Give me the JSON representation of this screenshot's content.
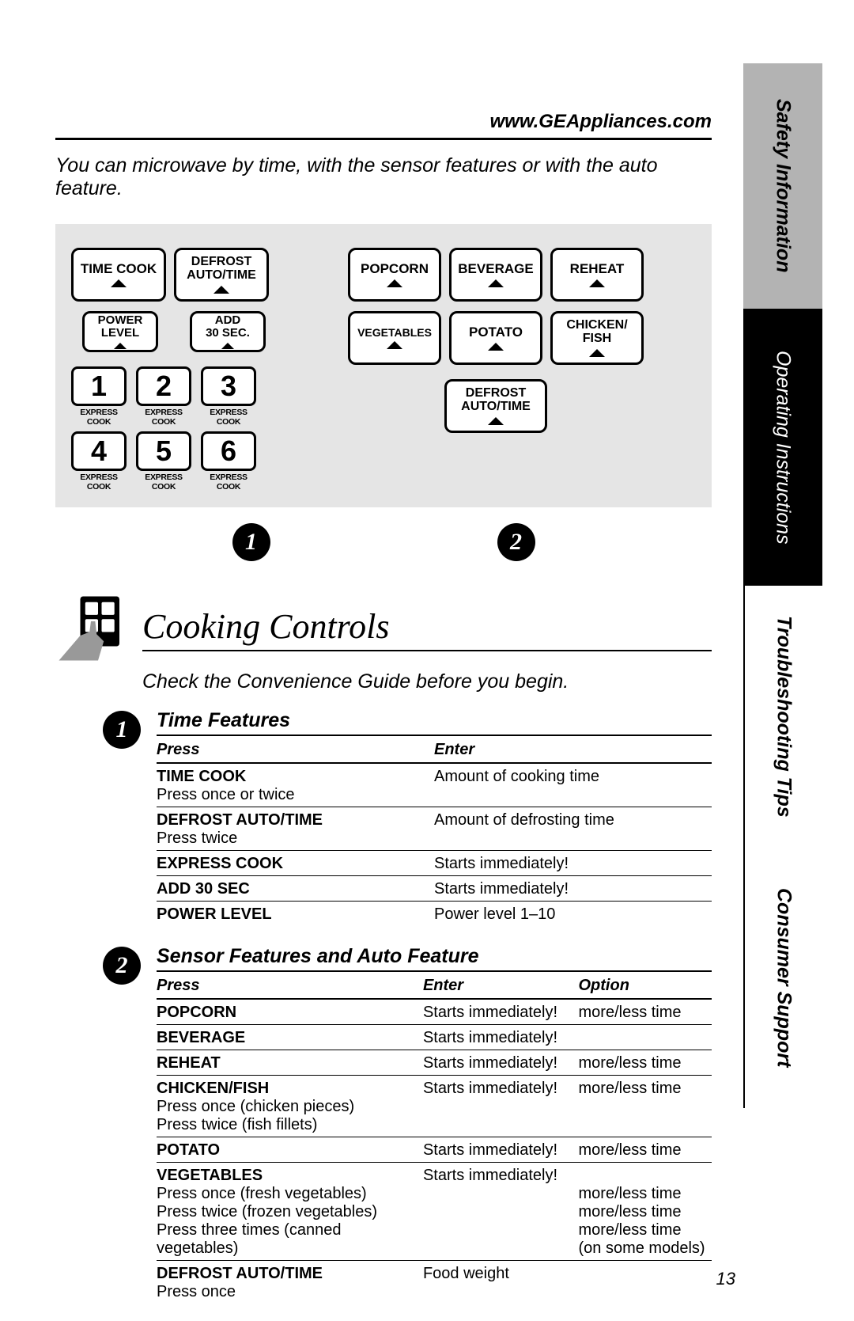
{
  "header": {
    "url": "www.GEAppliances.com",
    "intro": "You can microwave by time, with the sensor features or with the auto feature."
  },
  "panel": {
    "left": {
      "time_cook": "TIME COOK",
      "defrost": "DEFROST AUTO/TIME",
      "power": "POWER LEVEL",
      "add30": "ADD 30 SEC.",
      "express": "EXPRESS COOK",
      "nums": [
        "1",
        "2",
        "3",
        "4",
        "5",
        "6"
      ]
    },
    "right": {
      "popcorn": "POPCORN",
      "beverage": "BEVERAGE",
      "reheat": "REHEAT",
      "veg": "VEGETABLES",
      "potato": "POTATO",
      "chicken": "CHICKEN/ FISH",
      "defrost": "DEFROST AUTO/TIME"
    },
    "callout1": "1",
    "callout2": "2"
  },
  "section": {
    "title": "Cooking Controls",
    "subtitle": "Check the Convenience Guide before you begin."
  },
  "time_features": {
    "title": "Time Features",
    "head_press": "Press",
    "head_enter": "Enter",
    "rows": [
      {
        "press": "TIME COOK",
        "note": "Press once or twice",
        "enter": "Amount of cooking time"
      },
      {
        "press": "DEFROST AUTO/TIME",
        "note": "Press twice",
        "enter": "Amount of defrosting time"
      },
      {
        "press": "EXPRESS COOK",
        "enter": "Starts immediately!"
      },
      {
        "press": "ADD 30 SEC",
        "enter": "Starts immediately!"
      },
      {
        "press": "POWER LEVEL",
        "enter": "Power level 1–10"
      }
    ]
  },
  "sensor_features": {
    "title": "Sensor Features and Auto Feature",
    "head_press": "Press",
    "head_enter": "Enter",
    "head_option": "Option",
    "rows": [
      {
        "press": "POPCORN",
        "enter": "Starts immediately!",
        "option": "more/less time"
      },
      {
        "press": "BEVERAGE",
        "enter": "Starts immediately!",
        "option": ""
      },
      {
        "press": "REHEAT",
        "enter": "Starts immediately!",
        "option": "more/less time"
      },
      {
        "press": "CHICKEN/FISH",
        "notes": [
          "Press once (chicken pieces)",
          "Press twice (fish fillets)"
        ],
        "enter": "Starts immediately!",
        "option": "more/less time"
      },
      {
        "press": "POTATO",
        "enter": "Starts immediately!",
        "option": "more/less time"
      },
      {
        "press": "VEGETABLES",
        "notes": [
          "Press once (fresh vegetables)",
          "Press twice (frozen vegetables)",
          "Press three times (canned vegetables)"
        ],
        "enter": "Starts immediately!",
        "options": [
          "more/less time",
          "more/less time",
          "more/less time",
          "(on some models)"
        ]
      },
      {
        "press": "DEFROST AUTO/TIME",
        "notes": [
          "Press once"
        ],
        "enter": "Food weight",
        "option": ""
      }
    ]
  },
  "sidebar": {
    "tabs": [
      "Safety Information",
      "Operating Instructions",
      "Troubleshooting Tips",
      "Consumer Support"
    ]
  },
  "page_number": "13"
}
